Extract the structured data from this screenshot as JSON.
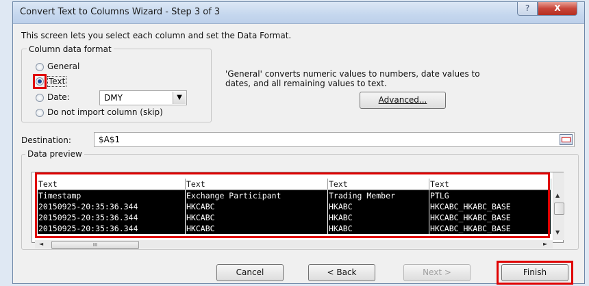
{
  "window": {
    "title": "Convert Text to Columns Wizard - Step 3 of 3",
    "help_label": "?",
    "close_label": "X"
  },
  "intro": "This screen lets you select each column and set the Data Format.",
  "format_group": {
    "label": "Column data format",
    "options": [
      {
        "label": "General",
        "selected": false
      },
      {
        "label": "Text",
        "selected": true
      },
      {
        "label": "Date:",
        "selected": false
      },
      {
        "label": "Do not import column (skip)",
        "selected": false
      }
    ],
    "date_value": "DMY"
  },
  "description": {
    "line1": "'General' converts numeric values to numbers, date values to",
    "line2": "dates, and all remaining values to text."
  },
  "advanced_label": "Advanced...",
  "destination": {
    "label": "Destination:",
    "value": "$A$1"
  },
  "preview": {
    "label": "Data preview",
    "headers": [
      "Text",
      "Text",
      "Text",
      "Text"
    ],
    "rows": [
      [
        "Timestamp",
        "Exchange Participant",
        "Trading Member",
        "PTLG"
      ],
      [
        "20150925-20:35:36.344",
        "HKCABC",
        "HKABC",
        "HKCABC_HKABC_BASE"
      ],
      [
        "20150925-20:35:36.344",
        "HKCABC",
        "HKABC",
        "HKCABC_HKABC_BASE"
      ],
      [
        "20150925-20:35:36.344",
        "HKCABC",
        "HKABC",
        "HKCABC_HKABC_BASE"
      ]
    ]
  },
  "buttons": {
    "cancel": "Cancel",
    "back": "< Back",
    "next": "Next >",
    "finish": "Finish"
  },
  "scroll_thumb_glyph": "III",
  "colors": {
    "highlight": "#e00000",
    "selection_bg": "#000000"
  }
}
